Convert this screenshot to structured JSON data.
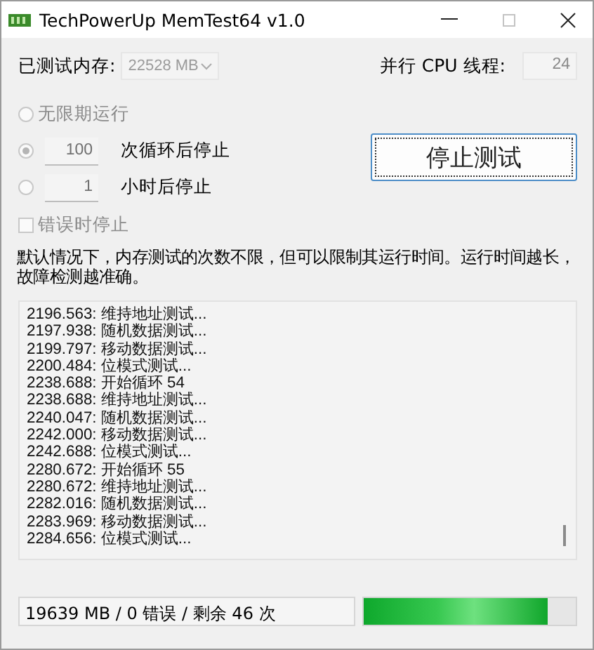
{
  "window": {
    "title": "TechPowerUp MemTest64 v1.0"
  },
  "memory": {
    "label": "已测试内存:",
    "value": "22528 MB",
    "disabled": true
  },
  "threads": {
    "label": "并行 CPU 线程:",
    "value": "24"
  },
  "run_modes": [
    {
      "label": "无限期运行",
      "selected": false,
      "disabled": true
    },
    {
      "value": "100",
      "label": "次循环后停止",
      "selected": true,
      "disabled": false
    },
    {
      "value": "1",
      "label": "小时后停止",
      "selected": false,
      "disabled": false
    }
  ],
  "stop_button": "停止测试",
  "stop_on_error": {
    "label": "错误时停止",
    "checked": false,
    "disabled": true
  },
  "description": "默认情况下，内存测试的次数不限，但可以限制其运行时间。运行时间越长，故障检测越准确。",
  "log": [
    "2196.563: 维持地址测试...",
    "2197.938: 随机数据测试...",
    "2199.797: 移动数据测试...",
    "2200.484: 位模式测试...",
    "2238.688: 开始循环 54",
    "2238.688: 维持地址测试...",
    "2240.047: 随机数据测试...",
    "2242.000: 移动数据测试...",
    "2242.688: 位模式测试...",
    "2280.672: 开始循环 55",
    "2280.672: 维持地址测试...",
    "2282.016: 随机数据测试...",
    "2283.969: 移动数据测试...",
    "2284.656: 位模式测试..."
  ],
  "status": {
    "text": "19639 MB / 0 错误 / 剩余 46 次",
    "level": 0.87
  }
}
